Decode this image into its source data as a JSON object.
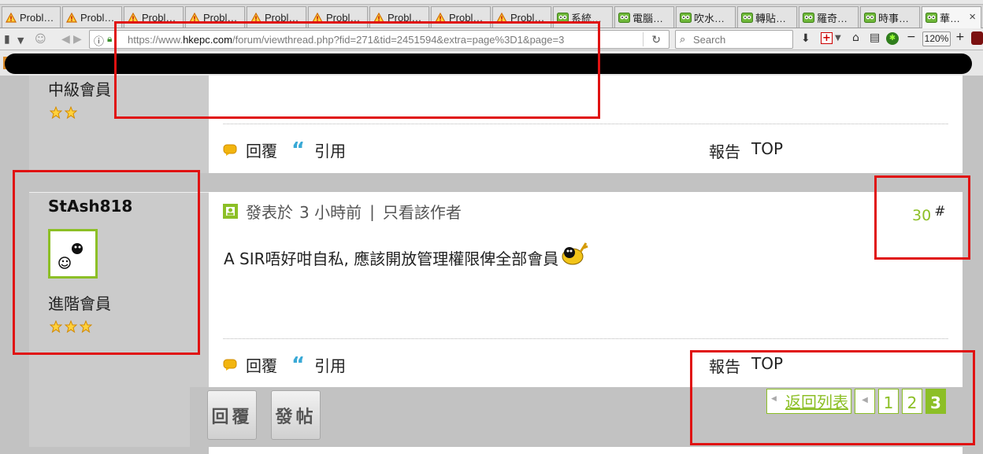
{
  "tabs": [
    {
      "label": "Probl…",
      "icon": "warning-icon"
    },
    {
      "label": "Probl…",
      "icon": "warning-icon"
    },
    {
      "label": "Probl…",
      "icon": "warning-icon"
    },
    {
      "label": "Probl…",
      "icon": "warning-icon"
    },
    {
      "label": "Probl…",
      "icon": "warning-icon"
    },
    {
      "label": "Probl…",
      "icon": "warning-icon"
    },
    {
      "label": "Probl…",
      "icon": "warning-icon"
    },
    {
      "label": "Probl…",
      "icon": "warning-icon"
    },
    {
      "label": "Probl…",
      "icon": "warning-icon"
    },
    {
      "label": "系統…",
      "icon": "hkepc-favicon-icon"
    },
    {
      "label": "電腦…",
      "icon": "hkepc-favicon-icon"
    },
    {
      "label": "吹水…",
      "icon": "hkepc-favicon-icon"
    },
    {
      "label": "轉貼…",
      "icon": "hkepc-favicon-icon"
    },
    {
      "label": "羅奇…",
      "icon": "hkepc-favicon-icon"
    },
    {
      "label": "時事…",
      "icon": "hkepc-favicon-icon"
    },
    {
      "label": "華…",
      "icon": "hkepc-favicon-icon",
      "active": true
    }
  ],
  "tab_close": "×",
  "navbar": {
    "url_prefix": "https://www.",
    "url_domain": "hkepc.com",
    "url_path": "/forum/viewthread.php?fid=271&tid=2451594&extra=page%3D1&page=3",
    "search_placeholder": "Search",
    "zoom": "120%",
    "zoom_minus": "−",
    "zoom_plus": "+"
  },
  "prev_post": {
    "rank": "中級會員",
    "stars": 2,
    "reply_label": "回覆",
    "quote_label": "引用",
    "report_label": "報告",
    "top_label": "TOP"
  },
  "post": {
    "username": "StAsh818",
    "rank": "進階會員",
    "stars": 3,
    "posted_label": "發表於",
    "posted_time": "3 小時前",
    "separator": "|",
    "author_only_label": "只看該作者",
    "body": "A SIR唔好咁自私, 應該開放管理權限俾全部會員",
    "floor_number": "30",
    "floor_symbol": "#",
    "reply_label": "回覆",
    "quote_label": "引用",
    "report_label": "報告",
    "top_label": "TOP"
  },
  "bottom": {
    "reply_button": "回覆",
    "new_post_button": "發帖",
    "back_to_list": "返回列表",
    "pages": [
      "1",
      "2",
      "3"
    ],
    "current_page": "3"
  },
  "colors": {
    "accent_green": "#8cbf26",
    "annotation_red": "#e01212",
    "quote_blue": "#39a9d6"
  }
}
